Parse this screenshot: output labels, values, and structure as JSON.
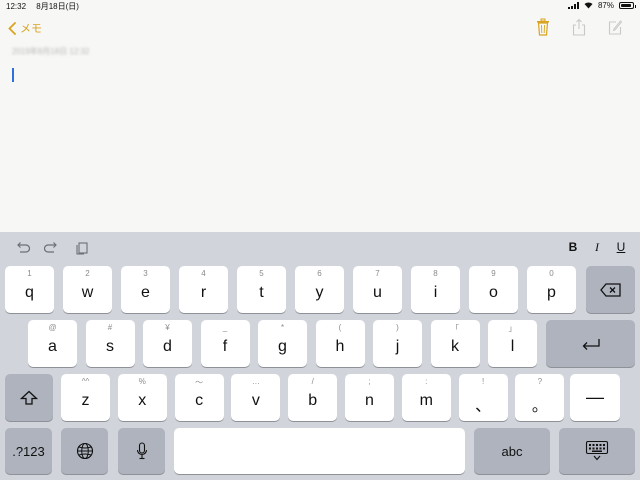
{
  "status_bar": {
    "time": "12:32",
    "date": "8月18日(日)",
    "battery_percent": "87%",
    "battery_level": 0.87
  },
  "nav": {
    "back_label": "メモ",
    "accent_color": "#d9a420"
  },
  "note": {
    "date_text": "2019年8月18日 12:32"
  },
  "shortcut_bar": {
    "bold": "B",
    "italic": "I",
    "underline": "U"
  },
  "keyboard": {
    "row1": [
      {
        "main": "q",
        "sub": "1"
      },
      {
        "main": "w",
        "sub": "2"
      },
      {
        "main": "e",
        "sub": "3"
      },
      {
        "main": "r",
        "sub": "4"
      },
      {
        "main": "t",
        "sub": "5"
      },
      {
        "main": "y",
        "sub": "6"
      },
      {
        "main": "u",
        "sub": "7"
      },
      {
        "main": "i",
        "sub": "8"
      },
      {
        "main": "o",
        "sub": "9"
      },
      {
        "main": "p",
        "sub": "0"
      }
    ],
    "row2": [
      {
        "main": "a",
        "sub": "@"
      },
      {
        "main": "s",
        "sub": "#"
      },
      {
        "main": "d",
        "sub": "¥"
      },
      {
        "main": "f",
        "sub": "_"
      },
      {
        "main": "g",
        "sub": "*"
      },
      {
        "main": "h",
        "sub": "("
      },
      {
        "main": "j",
        "sub": ")"
      },
      {
        "main": "k",
        "sub": "「"
      },
      {
        "main": "l",
        "sub": "」"
      }
    ],
    "row3": [
      {
        "main": "z",
        "sub": "^^"
      },
      {
        "main": "x",
        "sub": "%"
      },
      {
        "main": "c",
        "sub": "〜"
      },
      {
        "main": "v",
        "sub": "…"
      },
      {
        "main": "b",
        "sub": "/"
      },
      {
        "main": "n",
        "sub": ";"
      },
      {
        "main": "m",
        "sub": ":"
      },
      {
        "main": "、",
        "sub": "!"
      },
      {
        "main": "。",
        "sub": "?"
      }
    ],
    "dash_key": "—",
    "num_key": ".?123",
    "abc_key": "abc"
  }
}
